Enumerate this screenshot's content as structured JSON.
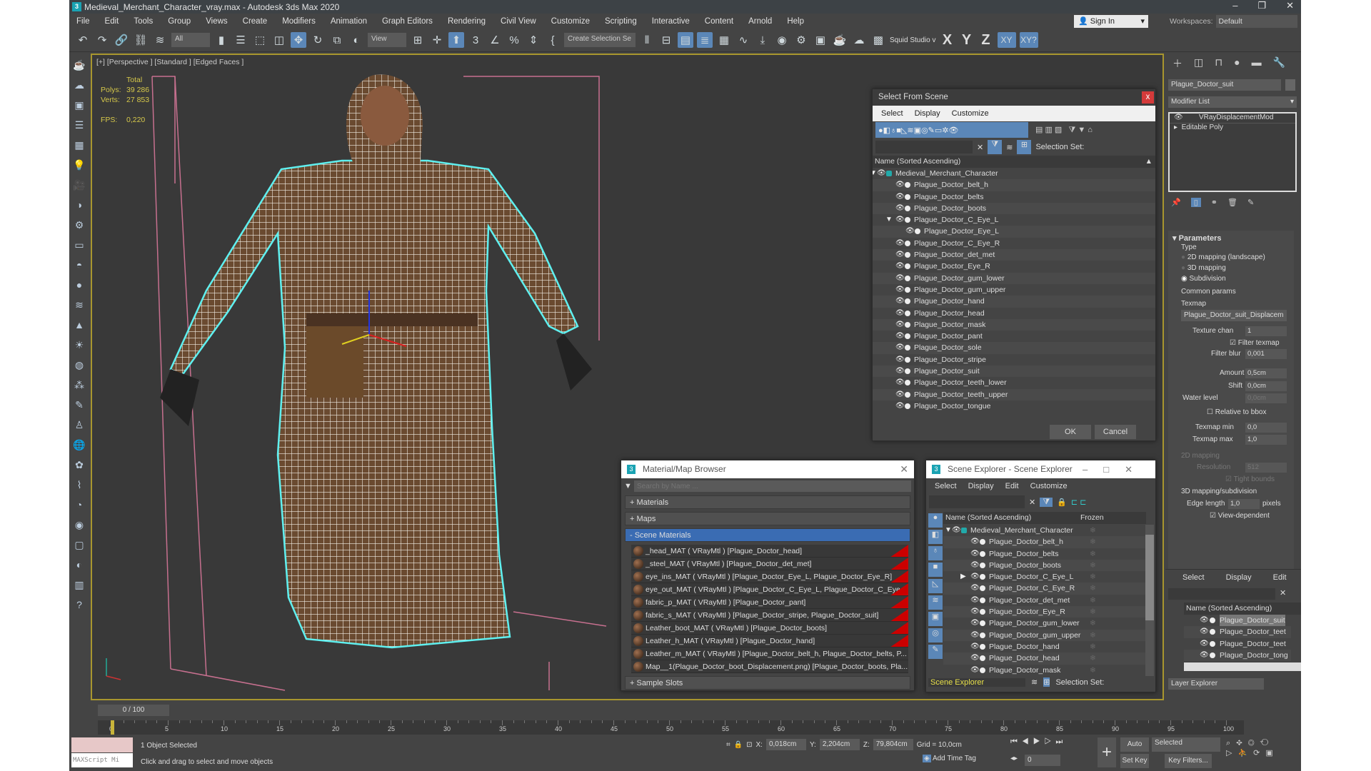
{
  "window": {
    "title": "Medieval_Merchant_Character_vray.max - Autodesk 3ds Max 2020",
    "controls": [
      "–",
      "❐",
      "✕"
    ]
  },
  "menu": [
    "File",
    "Edit",
    "Tools",
    "Group",
    "Views",
    "Create",
    "Modifiers",
    "Animation",
    "Graph Editors",
    "Rendering",
    "Civil View",
    "Customize",
    "Scripting",
    "Interactive",
    "Content",
    "Arnold",
    "Help"
  ],
  "account": {
    "sign_in": "Sign In",
    "workspaces_label": "Workspaces:",
    "workspace": "Default"
  },
  "toolbar": {
    "filter": "All",
    "ref_coord": "View",
    "selection_set": "Create Selection Se",
    "studio": "Squid Studio v",
    "axes": [
      "X",
      "Y",
      "Z",
      "XY",
      "XY?"
    ]
  },
  "viewport": {
    "label": "[+] [Perspective ] [Standard ] [Edged Faces ]",
    "stats": {
      "total_label": "Total",
      "polys_label": "Polys:",
      "polys": "39 286",
      "verts_label": "Verts:",
      "verts": "27 853",
      "fps_label": "FPS:",
      "fps": "0,220"
    }
  },
  "select_from_scene": {
    "title": "Select From Scene",
    "close": "x",
    "menu": [
      "Select",
      "Display",
      "Customize"
    ],
    "selection_set_label": "Selection Set:",
    "column": "Name (Sorted Ascending)",
    "items": [
      {
        "name": "Medieval_Merchant_Character",
        "level": 0,
        "expand": "▼"
      },
      {
        "name": "Plague_Doctor_belt_h",
        "level": 1
      },
      {
        "name": "Plague_Doctor_belts",
        "level": 1
      },
      {
        "name": "Plague_Doctor_boots",
        "level": 1
      },
      {
        "name": "Plague_Doctor_C_Eye_L",
        "level": 1,
        "expand": "▼"
      },
      {
        "name": "Plague_Doctor_Eye_L",
        "level": 2
      },
      {
        "name": "Plague_Doctor_C_Eye_R",
        "level": 1
      },
      {
        "name": "Plague_Doctor_det_met",
        "level": 1
      },
      {
        "name": "Plague_Doctor_Eye_R",
        "level": 1
      },
      {
        "name": "Plague_Doctor_gum_lower",
        "level": 1
      },
      {
        "name": "Plague_Doctor_gum_upper",
        "level": 1
      },
      {
        "name": "Plague_Doctor_hand",
        "level": 1
      },
      {
        "name": "Plague_Doctor_head",
        "level": 1
      },
      {
        "name": "Plague_Doctor_mask",
        "level": 1
      },
      {
        "name": "Plague_Doctor_pant",
        "level": 1
      },
      {
        "name": "Plague_Doctor_sole",
        "level": 1
      },
      {
        "name": "Plague_Doctor_stripe",
        "level": 1
      },
      {
        "name": "Plague_Doctor_suit",
        "level": 1
      },
      {
        "name": "Plague_Doctor_teeth_lower",
        "level": 1
      },
      {
        "name": "Plague_Doctor_teeth_upper",
        "level": 1
      },
      {
        "name": "Plague_Doctor_tongue",
        "level": 1
      }
    ],
    "ok": "OK",
    "cancel": "Cancel"
  },
  "material_browser": {
    "title": "Material/Map Browser",
    "search_placeholder": "Search by Name ...",
    "sections": {
      "materials": "+ Materials",
      "maps": "+ Maps",
      "scene": "- Scene Materials",
      "slots": "+ Sample Slots"
    },
    "items": [
      "_head_MAT ( VRayMtl ) [Plague_Doctor_head]",
      "_steel_MAT ( VRayMtl ) [Plague_Doctor_det_met]",
      "eye_ins_MAT ( VRayMtl ) [Plague_Doctor_Eye_L, Plague_Doctor_Eye_R]",
      "eye_out_MAT ( VRayMtl ) [Plague_Doctor_C_Eye_L, Plague_Doctor_C_Eye_R]",
      "fabric_p_MAT ( VRayMtl ) [Plague_Doctor_pant]",
      "fabric_s_MAT ( VRayMtl ) [Plague_Doctor_stripe, Plague_Doctor_suit]",
      "Leather_boot_MAT ( VRayMtl ) [Plague_Doctor_boots]",
      "Leather_h_MAT ( VRayMtl ) [Plague_Doctor_hand]",
      "Leather_m_MAT ( VRayMtl ) [Plague_Doctor_belt_h, Plague_Doctor_belts, P...",
      "Map__1(Plague_Doctor_boot_Displacement.png) [Plague_Doctor_boots, Pla..."
    ]
  },
  "scene_explorer": {
    "title": "Scene Explorer - Scene Explorer",
    "menu": [
      "Select",
      "Display",
      "Edit",
      "Customize"
    ],
    "column": "Name (Sorted Ascending)",
    "frozen": "Frozen",
    "items": [
      {
        "name": "Medieval_Merchant_Character",
        "level": 0,
        "expand": "▼"
      },
      {
        "name": "Plague_Doctor_belt_h",
        "level": 1
      },
      {
        "name": "Plague_Doctor_belts",
        "level": 1
      },
      {
        "name": "Plague_Doctor_boots",
        "level": 1
      },
      {
        "name": "Plague_Doctor_C_Eye_L",
        "level": 1,
        "expand": "▶"
      },
      {
        "name": "Plague_Doctor_C_Eye_R",
        "level": 1
      },
      {
        "name": "Plague_Doctor_det_met",
        "level": 1
      },
      {
        "name": "Plague_Doctor_Eye_R",
        "level": 1
      },
      {
        "name": "Plague_Doctor_gum_lower",
        "level": 1
      },
      {
        "name": "Plague_Doctor_gum_upper",
        "level": 1
      },
      {
        "name": "Plague_Doctor_hand",
        "level": 1
      },
      {
        "name": "Plague_Doctor_head",
        "level": 1
      },
      {
        "name": "Plague_Doctor_mask",
        "level": 1
      }
    ],
    "footer": "Scene Explorer",
    "selection_set_label": "Selection Set:"
  },
  "command_panel": {
    "object_name": "Plague_Doctor_suit",
    "modifier_list": "Modifier List",
    "stack": [
      "VRayDisplacementMod",
      "Editable Poly"
    ],
    "parameters": {
      "title": "Parameters",
      "type_label": "Type",
      "types": [
        {
          "label": "2D mapping (landscape)",
          "selected": false
        },
        {
          "label": "3D mapping",
          "selected": false
        },
        {
          "label": "Subdivision",
          "selected": true
        }
      ],
      "common": "Common params",
      "texmap_label": "Texmap",
      "texmap": "Plague_Doctor_suit_Displacem",
      "texture_chan_label": "Texture chan",
      "texture_chan": "1",
      "filter_texmap": "Filter texmap",
      "filter_blur_label": "Filter blur",
      "filter_blur": "0,001",
      "amount_label": "Amount",
      "amount": "0,5cm",
      "shift_label": "Shift",
      "shift": "0,0cm",
      "water_label": "Water level",
      "water": "0,0cm",
      "relative_bbox": "Relative to bbox",
      "texmap_min_label": "Texmap min",
      "texmap_min": "0,0",
      "texmap_max_label": "Texmap max",
      "texmap_max": "1,0",
      "mapping2d": "2D mapping",
      "resolution_label": "Resolution",
      "resolution": "512",
      "tight_bounds": "Tight bounds",
      "mapping3d": "3D mapping/subdivision",
      "edge_length_label": "Edge length",
      "edge_length": "1,0",
      "pixels": "pixels",
      "view_dependent": "View-dependent"
    }
  },
  "layer_explorer": {
    "menu": [
      "Select",
      "Display",
      "Edit"
    ],
    "column": "Name (Sorted Ascending)",
    "items": [
      "Plague_Doctor_suit",
      "Plague_Doctor_teet",
      "Plague_Doctor_teet",
      "Plague_Doctor_tong"
    ],
    "footer": "Layer Explorer"
  },
  "timeline": {
    "frame": "0 / 100",
    "ticks": [
      "0",
      "5",
      "10",
      "15",
      "20",
      "25",
      "30",
      "35",
      "40",
      "45",
      "50",
      "55",
      "60",
      "65",
      "70",
      "75",
      "80",
      "85",
      "90",
      "95",
      "100"
    ],
    "progress": 0
  },
  "status": {
    "maxscript": "MAXScript Mi",
    "selected": "1 Object Selected",
    "hint": "Click and drag to select and move objects",
    "x_label": "X:",
    "x": "0,018cm",
    "y_label": "Y:",
    "y": "2,204cm",
    "z_label": "Z:",
    "z": "79,804cm",
    "grid": "Grid = 10,0cm",
    "add_time_tag": "Add Time Tag",
    "auto_key": "Auto Key",
    "key_mode": "Selected",
    "set_key": "Set Key",
    "key_filters": "Key Filters...",
    "current_frame": "0"
  },
  "colors": {
    "accent": "#5b87b8",
    "selection_outline": "#5ff0f0",
    "close_red": "#d43a3a",
    "scene_materials": "#3a6cb3"
  }
}
